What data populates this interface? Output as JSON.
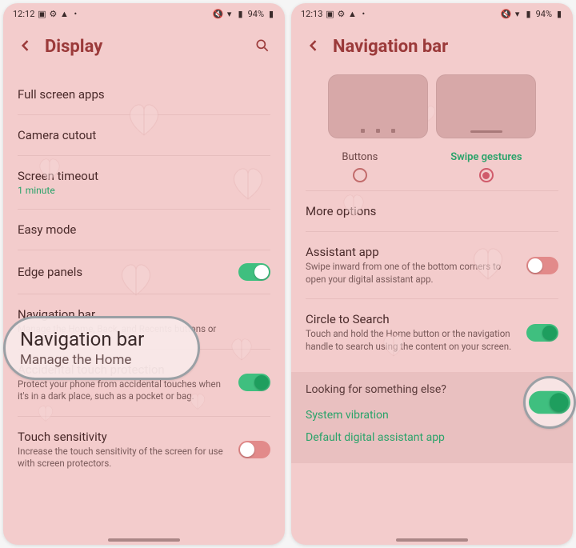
{
  "screen1": {
    "statusbar": {
      "time": "12:12",
      "battery": "94%"
    },
    "title": "Display",
    "items": {
      "full_screen_apps": {
        "label": "Full screen apps"
      },
      "camera_cutout": {
        "label": "Camera cutout"
      },
      "screen_timeout": {
        "label": "Screen timeout",
        "value": "1 minute"
      },
      "easy_mode": {
        "label": "Easy mode"
      },
      "edge_panels": {
        "label": "Edge panels",
        "toggle": true
      },
      "navigation_bar": {
        "label": "Navigation bar",
        "desc": "Manage the Home, Back, and Recents buttons or"
      },
      "accidental_touch": {
        "label": "Accidental touch protection",
        "desc": "Protect your phone from accidental touches when it's in a dark place, such as a pocket or bag.",
        "toggle": true
      },
      "touch_sensitivity": {
        "label": "Touch sensitivity",
        "desc": "Increase the touch sensitivity of the screen for use with screen protectors.",
        "toggle": false
      }
    },
    "callout": {
      "title": "Navigation bar",
      "sub": "Manage the Home"
    }
  },
  "screen2": {
    "statusbar": {
      "time": "12:13",
      "battery": "94%"
    },
    "title": "Navigation bar",
    "nav_options": {
      "buttons": "Buttons",
      "swipe": "Swipe gestures",
      "selected": "swipe"
    },
    "items": {
      "more_options": {
        "label": "More options"
      },
      "assistant_app": {
        "label": "Assistant app",
        "desc": "Swipe inward from one of the bottom corners to open your digital assistant app.",
        "toggle": false
      },
      "circle_to_search": {
        "label": "Circle to Search",
        "desc": "Touch and hold the Home button or the navigation handle to search using the content on your screen.",
        "toggle": true
      }
    },
    "footer": {
      "heading": "Looking for something else?",
      "link1": "System vibration",
      "link2": "Default digital assistant app"
    }
  }
}
